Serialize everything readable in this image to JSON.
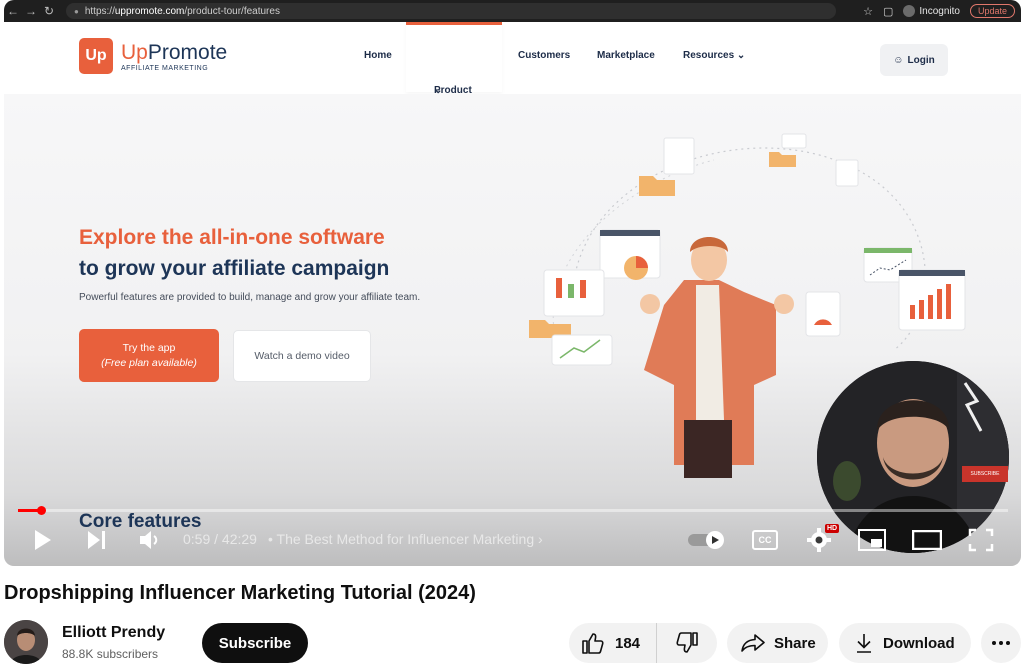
{
  "browser": {
    "url_host": "uppromote.com",
    "url_prefix": "https://",
    "url_path": "/product-tour/features",
    "incognito_label": "Incognito",
    "update_label": "Update"
  },
  "site": {
    "logo_up": "Up",
    "logo_promote": "Promote",
    "logo_subtitle": "AFFILIATE MARKETING",
    "nav": {
      "home": "Home",
      "product_tour": "Product tour",
      "customers": "Customers",
      "marketplace": "Marketplace",
      "resources": "Resources"
    },
    "login": "Login"
  },
  "hero": {
    "title_line1": "Explore the all-in-one software",
    "title_line2": "to grow your affiliate campaign",
    "description": "Powerful features are provided to build, manage and grow your affiliate team.",
    "try_button_line1": "Try the app",
    "try_button_line2": "(Free plan available)",
    "demo_button": "Watch a demo video",
    "section_heading": "Core features"
  },
  "facecam": {
    "badge": "SUBSCRIBE"
  },
  "player": {
    "current_time": "0:59",
    "duration": "42:29",
    "time_display": "0:59 / 42:29",
    "chapter": "The Best Method for Influencer Marketing",
    "progress_fraction": 0.023,
    "cc_label": "CC",
    "hd_label": "HD",
    "accent_color": "#ff0000"
  },
  "video": {
    "title": "Dropshipping Influencer Marketing Tutorial (2024)",
    "channel_name": "Elliott Prendy",
    "subscribers": "88.8K subscribers",
    "subscribe_label": "Subscribe",
    "like_count": "184",
    "share_label": "Share",
    "download_label": "Download"
  },
  "icons": {
    "like": "thumbs-up-icon",
    "dislike": "thumbs-down-icon",
    "share": "share-arrow-icon",
    "download": "download-icon",
    "more": "more-dots-icon"
  }
}
